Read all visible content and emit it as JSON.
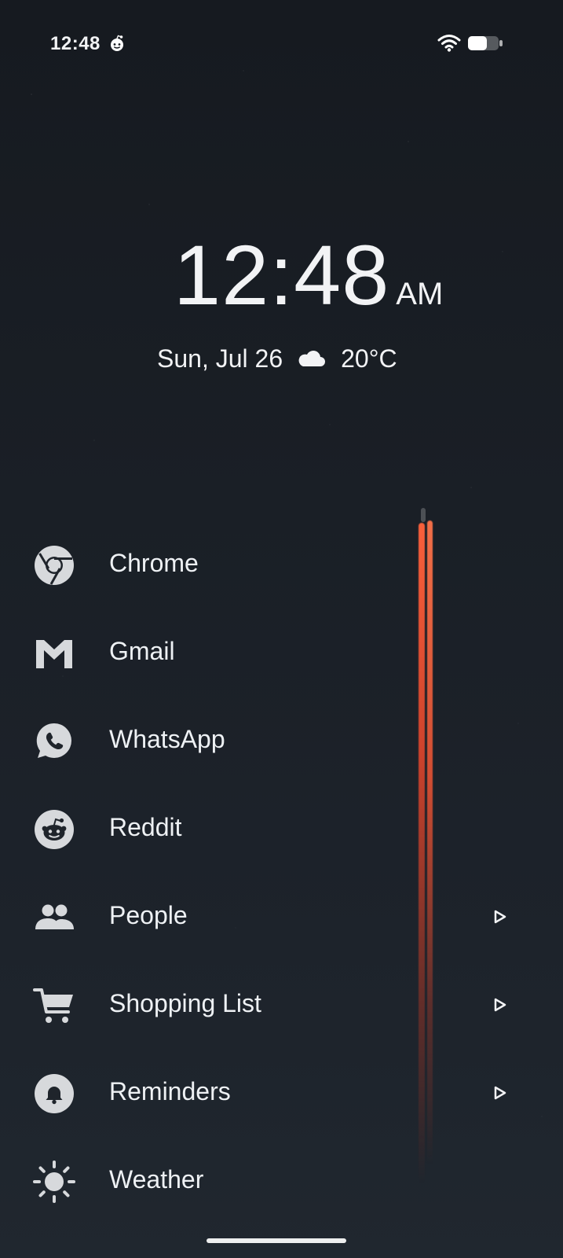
{
  "status_bar": {
    "time": "12:48",
    "icons": [
      "reddit-status-icon",
      "wifi-icon",
      "battery-icon"
    ]
  },
  "clock_widget": {
    "time": "12:48",
    "period": "AM",
    "date": "Sun, Jul 26",
    "weather_icon": "cloud-icon",
    "temperature": "20°C"
  },
  "apps": [
    {
      "label": "Chrome",
      "icon": "chrome-icon",
      "has_chevron": false
    },
    {
      "label": "Gmail",
      "icon": "gmail-icon",
      "has_chevron": false
    },
    {
      "label": "WhatsApp",
      "icon": "whatsapp-icon",
      "has_chevron": false
    },
    {
      "label": "Reddit",
      "icon": "reddit-icon",
      "has_chevron": false
    },
    {
      "label": "People",
      "icon": "people-icon",
      "has_chevron": true
    },
    {
      "label": "Shopping List",
      "icon": "shopping-cart-icon",
      "has_chevron": true
    },
    {
      "label": "Reminders",
      "icon": "bell-icon",
      "has_chevron": true
    },
    {
      "label": "Weather",
      "icon": "sun-icon",
      "has_chevron": false
    }
  ]
}
